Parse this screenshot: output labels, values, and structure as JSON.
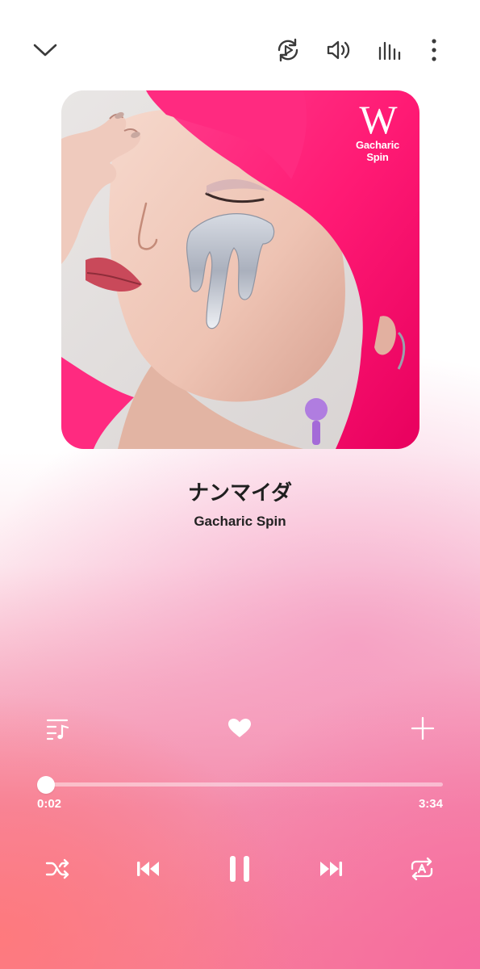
{
  "top_bar": {
    "icons": [
      "chevron-down-icon",
      "smart-view-icon",
      "volume-icon",
      "equalizer-icon",
      "more-options-icon"
    ]
  },
  "album": {
    "brand_mark": "W",
    "brand_name": "Gacharic Spin"
  },
  "track": {
    "title": "ナンマイダ",
    "artist": "Gacharic Spin"
  },
  "actions": {
    "icons": [
      "queue-icon",
      "heart-icon",
      "add-icon"
    ],
    "favorited": true
  },
  "progress": {
    "elapsed": "0:02",
    "duration": "3:34",
    "fraction": 0.01
  },
  "controls": {
    "icons": [
      "shuffle-icon",
      "previous-icon",
      "pause-icon",
      "next-icon",
      "repeat-icon"
    ],
    "state": "playing"
  },
  "colors": {
    "accent": "#ffffff",
    "background_pink": "#f77f99",
    "hair_pink": "#ff1f7a"
  }
}
